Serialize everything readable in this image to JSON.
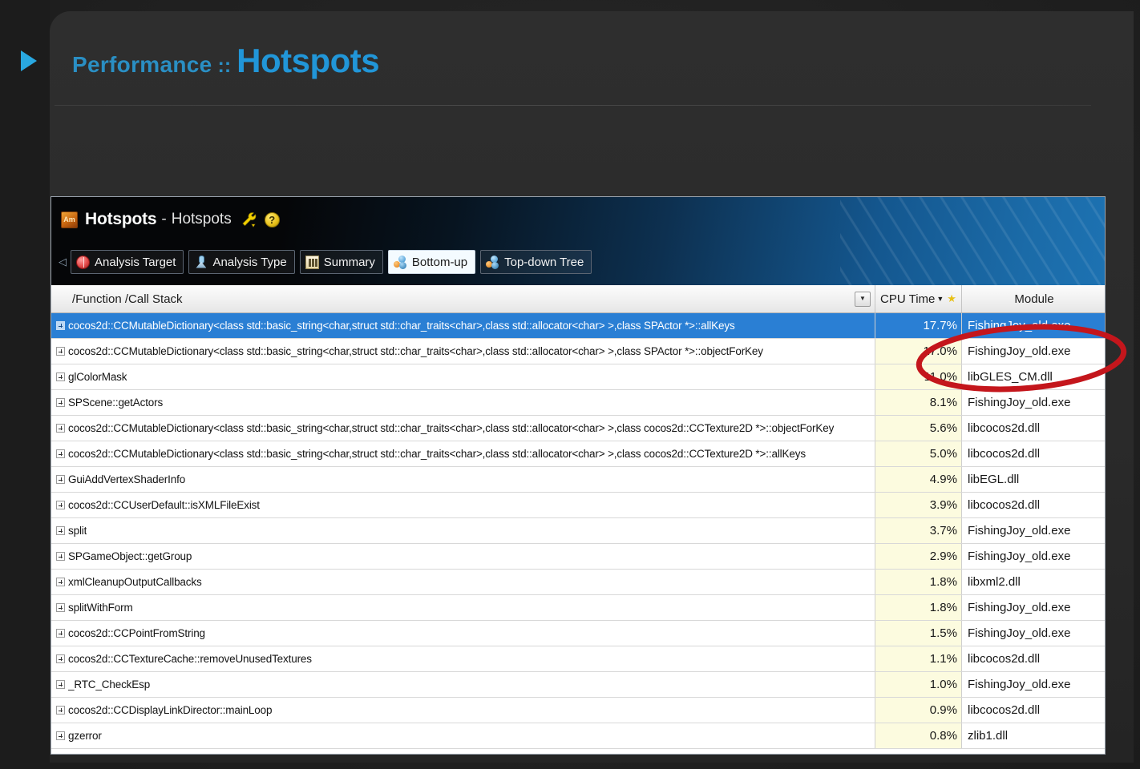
{
  "slide": {
    "title_small": "Performance",
    "title_separator": "::",
    "title_big": "Hotspots",
    "bullet_icon": "triangle-right-icon",
    "accent_color": "#2196d8"
  },
  "vtune": {
    "app_icon": "Am",
    "title_main": "Hotspots",
    "title_dash": "-",
    "title_sub": "Hotspots",
    "wrench_icon": "wrench-icon",
    "help_icon": "?",
    "collapse_arrow": "◁",
    "toolbar": [
      {
        "label": "Analysis Target",
        "icon": "target-icon",
        "active": false
      },
      {
        "label": "Analysis Type",
        "icon": "analysis-type-icon",
        "active": false
      },
      {
        "label": "Summary",
        "icon": "summary-icon",
        "active": false
      },
      {
        "label": "Bottom-up",
        "icon": "bubbles-icon",
        "active": true
      },
      {
        "label": "Top-down Tree",
        "icon": "bubbles-icon",
        "active": false
      }
    ],
    "table": {
      "columns": {
        "function": "/Function /Call Stack",
        "cpu_time": "CPU Time",
        "cpu_sort_caret": "▼",
        "cpu_star": "★",
        "module": "Module",
        "filter_caret": "▼"
      },
      "rows": [
        {
          "function": "cocos2d::CCMutableDictionary<class std::basic_string<char,struct std::char_traits<char>,class std::allocator<char> >,class SPActor *>::allKeys",
          "cpu_time": "17.7%",
          "module": "FishingJoy_old.exe",
          "selected": true
        },
        {
          "function": "cocos2d::CCMutableDictionary<class std::basic_string<char,struct std::char_traits<char>,class std::allocator<char> >,class SPActor *>::objectForKey",
          "cpu_time": "17.0%",
          "module": "FishingJoy_old.exe",
          "selected": false
        },
        {
          "function": "glColorMask",
          "cpu_time": "11.0%",
          "module": "libGLES_CM.dll",
          "selected": false
        },
        {
          "function": "SPScene::getActors",
          "cpu_time": "8.1%",
          "module": "FishingJoy_old.exe",
          "selected": false
        },
        {
          "function": "cocos2d::CCMutableDictionary<class std::basic_string<char,struct std::char_traits<char>,class std::allocator<char> >,class cocos2d::CCTexture2D *>::objectForKey",
          "cpu_time": "5.6%",
          "module": "libcocos2d.dll",
          "selected": false
        },
        {
          "function": "cocos2d::CCMutableDictionary<class std::basic_string<char,struct std::char_traits<char>,class std::allocator<char> >,class cocos2d::CCTexture2D *>::allKeys",
          "cpu_time": "5.0%",
          "module": "libcocos2d.dll",
          "selected": false
        },
        {
          "function": "GuiAddVertexShaderInfo",
          "cpu_time": "4.9%",
          "module": "libEGL.dll",
          "selected": false
        },
        {
          "function": "cocos2d::CCUserDefault::isXMLFileExist",
          "cpu_time": "3.9%",
          "module": "libcocos2d.dll",
          "selected": false
        },
        {
          "function": "split",
          "cpu_time": "3.7%",
          "module": "FishingJoy_old.exe",
          "selected": false
        },
        {
          "function": "SPGameObject::getGroup",
          "cpu_time": "2.9%",
          "module": "FishingJoy_old.exe",
          "selected": false
        },
        {
          "function": "xmlCleanupOutputCallbacks",
          "cpu_time": "1.8%",
          "module": "libxml2.dll",
          "selected": false
        },
        {
          "function": "splitWithForm",
          "cpu_time": "1.8%",
          "module": "FishingJoy_old.exe",
          "selected": false
        },
        {
          "function": "cocos2d::CCPointFromString",
          "cpu_time": "1.5%",
          "module": "FishingJoy_old.exe",
          "selected": false
        },
        {
          "function": "cocos2d::CCTextureCache::removeUnusedTextures",
          "cpu_time": "1.1%",
          "module": "libcocos2d.dll",
          "selected": false
        },
        {
          "function": "_RTC_CheckEsp",
          "cpu_time": "1.0%",
          "module": "FishingJoy_old.exe",
          "selected": false
        },
        {
          "function": "cocos2d::CCDisplayLinkDirector::mainLoop",
          "cpu_time": "0.9%",
          "module": "libcocos2d.dll",
          "selected": false
        },
        {
          "function": "gzerror",
          "cpu_time": "0.8%",
          "module": "zlib1.dll",
          "selected": false
        }
      ]
    }
  },
  "annotation": {
    "shape": "red-ellipse",
    "color": "#c4161c"
  }
}
